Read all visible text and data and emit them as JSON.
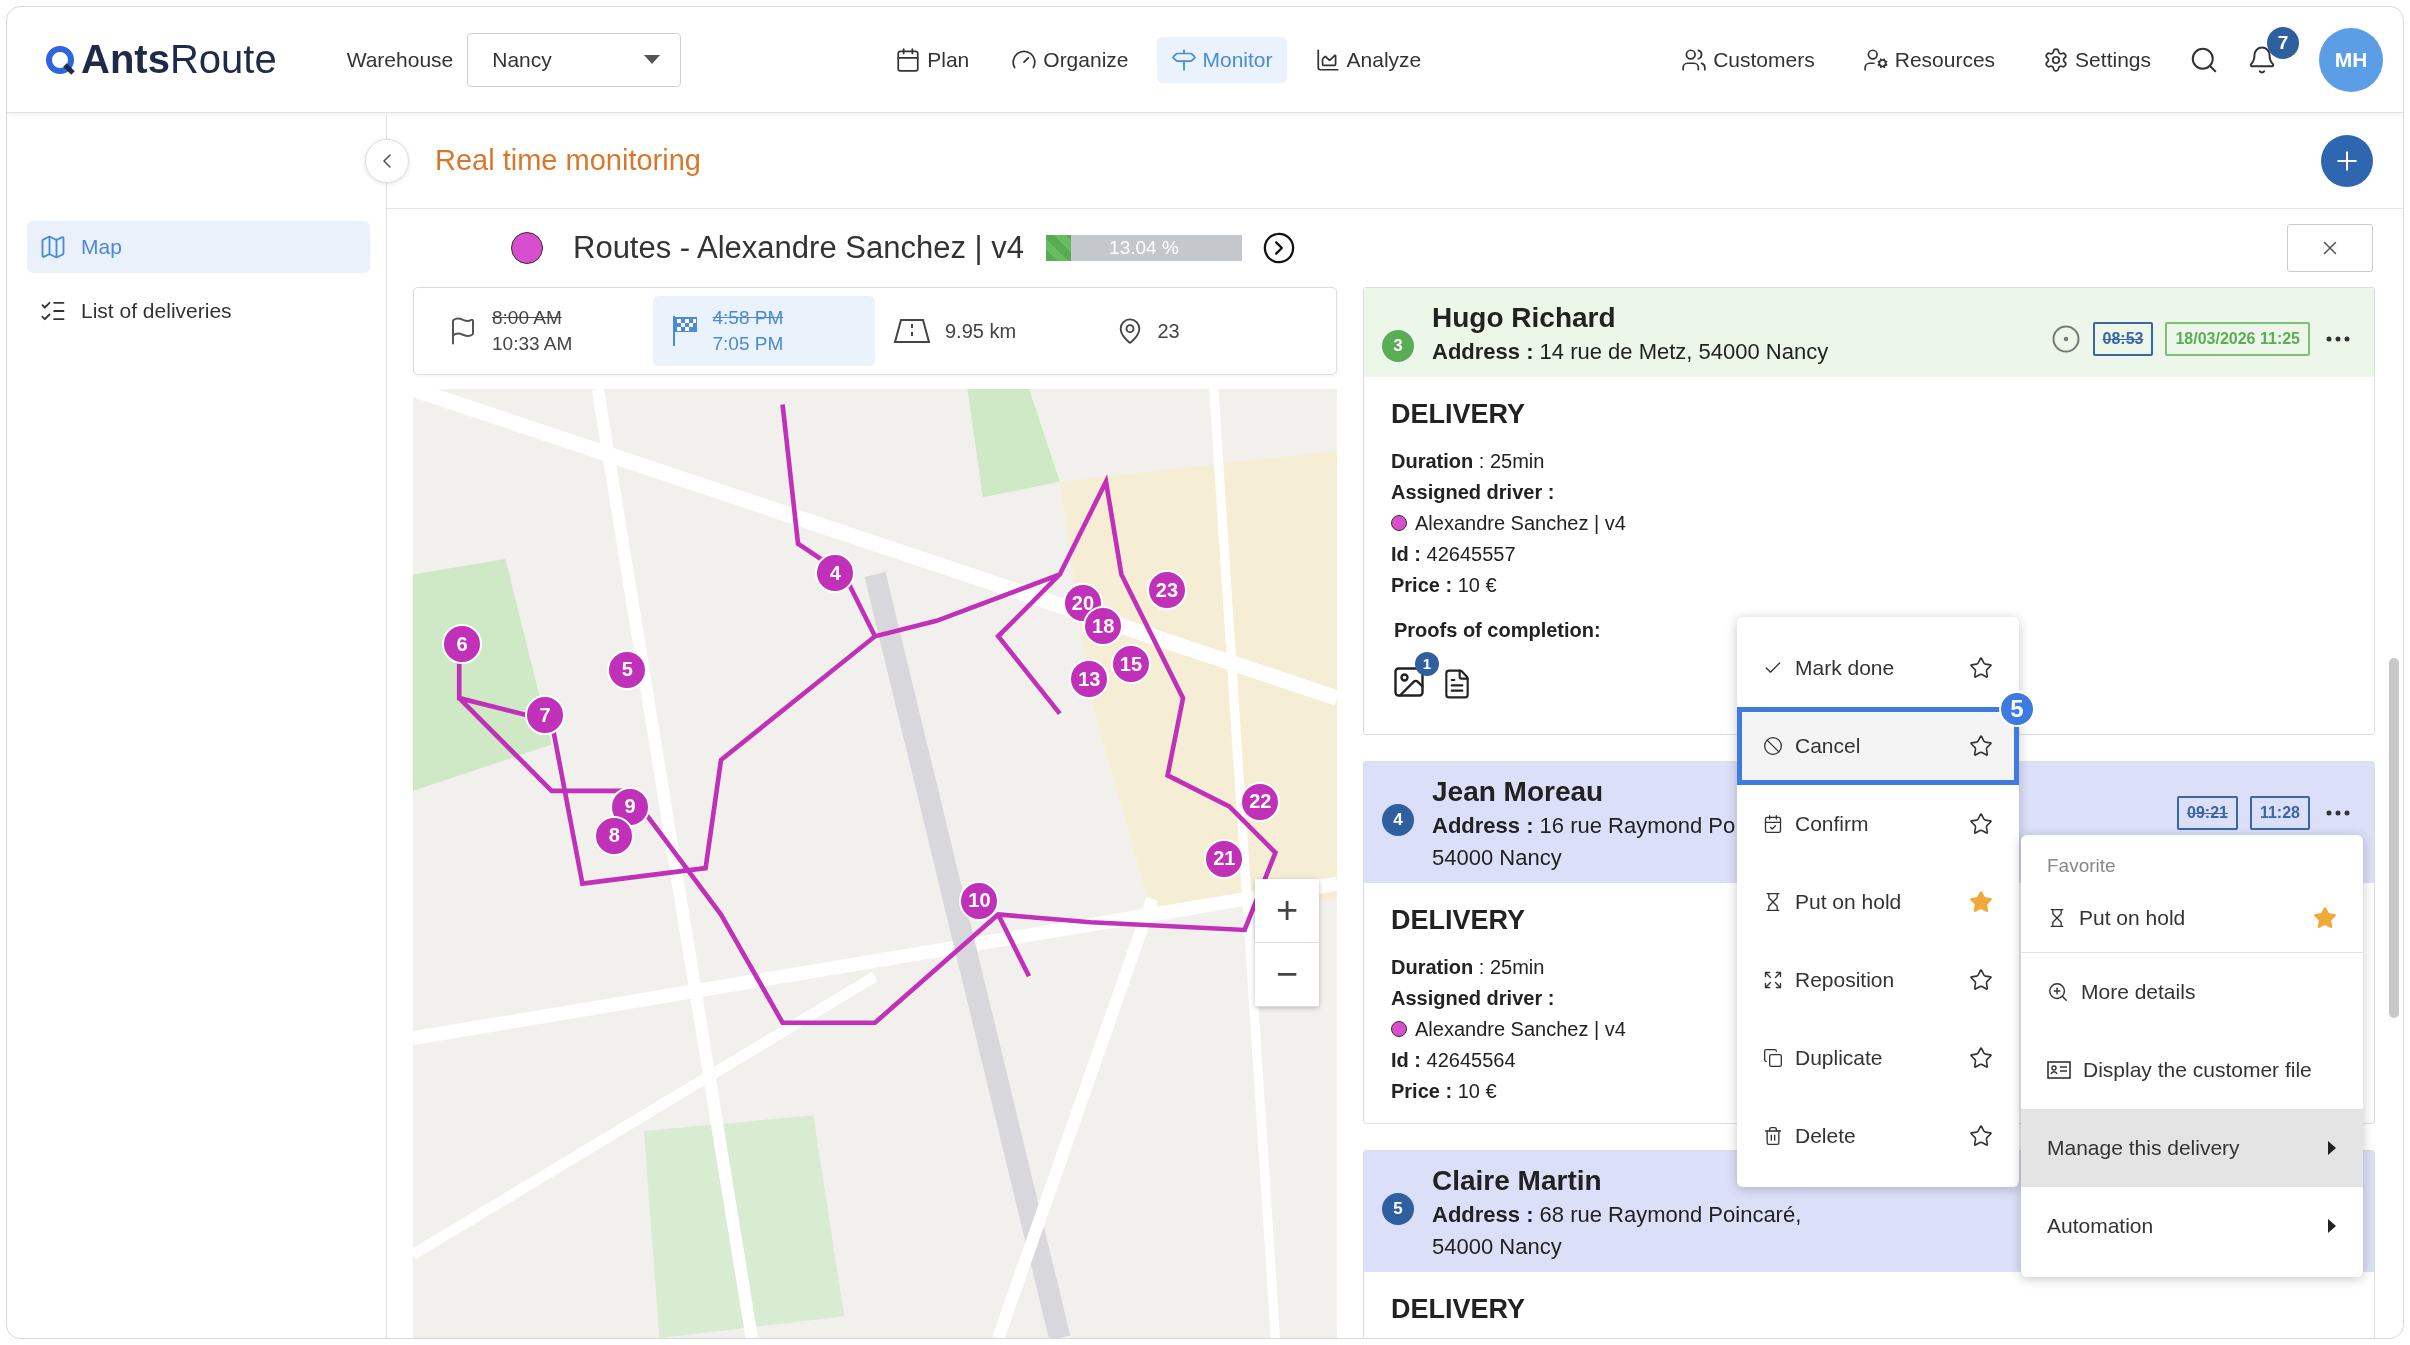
{
  "header": {
    "logo": {
      "bold": "Ants",
      "light": "Route"
    },
    "warehouse_label": "Warehouse",
    "warehouse": "Nancy",
    "nav": [
      {
        "kind": "plan",
        "label": "Plan",
        "selected": false
      },
      {
        "kind": "organize",
        "label": "Organize",
        "selected": false
      },
      {
        "kind": "monitor",
        "label": "Monitor",
        "selected": true
      },
      {
        "kind": "analyze",
        "label": "Analyze",
        "selected": false
      }
    ],
    "tools": [
      {
        "kind": "customers",
        "label": "Customers"
      },
      {
        "kind": "resources",
        "label": "Resources"
      },
      {
        "kind": "settings",
        "label": "Settings"
      }
    ],
    "notifications": "7",
    "avatar": "MH"
  },
  "sidebar": {
    "items": [
      {
        "kind": "map",
        "label": "Map",
        "selected": true
      },
      {
        "kind": "list",
        "label": "List of deliveries",
        "selected": false
      }
    ]
  },
  "page_title": "Real time monitoring",
  "route": {
    "color": "#d84fce",
    "title": "Routes - Alexandre Sanchez | v4",
    "progress": {
      "level": 0.1304,
      "reading": "13.04 %"
    }
  },
  "summary": [
    {
      "kind": "start",
      "planned": "8:00 AM",
      "actual": "10:33 AM",
      "selected": false
    },
    {
      "kind": "end",
      "planned": "4:58 PM",
      "actual": "7:05 PM",
      "selected": true
    },
    {
      "kind": "distance",
      "value": "9.95 km",
      "selected": false
    },
    {
      "kind": "stops",
      "value": "23",
      "selected": false
    }
  ],
  "map": {
    "zoom_in": "+",
    "zoom_out": "−",
    "pins": [
      "4",
      "5",
      "6",
      "7",
      "9",
      "8",
      "10",
      "20",
      "18",
      "13",
      "15",
      "23",
      "22",
      "21"
    ]
  },
  "stops": [
    {
      "number": "3",
      "completed": true,
      "name": "Hugo Richard",
      "tracked": true,
      "address": [
        "**Address :** 14 rue de Metz, 54000 Nancy"
      ],
      "times": [
        {
          "kind": "planned",
          "text": "08:53"
        },
        {
          "kind": "done",
          "text": "18/03/2026 11:25"
        }
      ],
      "details": {
        "type": "DELIVERY",
        "lines": [
          "**Duration** : 25min",
          "**Assigned driver :**"
        ],
        "driver": {
          "name": "Alexandre Sanchez | v4",
          "color": "#d84fce"
        },
        "after": [
          "**Id :** 42645557",
          "**Price :** 10 €"
        ],
        "proofs": {
          "label": "Proofs of completion:",
          "photo_count": "1"
        }
      }
    },
    {
      "number": "4",
      "completed": false,
      "name": "Jean Moreau",
      "tracked": false,
      "address": [
        "**Address :** 16 rue Raymond Po",
        "54000 Nancy"
      ],
      "times": [
        {
          "kind": "planned",
          "text": "09:21"
        },
        {
          "kind": "estimated",
          "text": "11:28"
        }
      ],
      "details": {
        "type": "DELIVERY",
        "lines": [
          "**Duration** : 25min",
          "**Assigned driver :**"
        ],
        "driver": {
          "name": "Alexandre Sanchez | v4",
          "color": "#d84fce"
        },
        "after": [
          "**Id :** 42645564",
          "**Price :** 10 €"
        ]
      }
    },
    {
      "number": "5",
      "completed": false,
      "name": "Claire Martin",
      "address": [
        "**Address :** 68 rue Raymond Poincaré,",
        "54000 Nancy"
      ],
      "details": {
        "type": "DELIVERY"
      }
    }
  ],
  "action_menu": [
    {
      "kind": "done",
      "label": "Mark done",
      "favorite": false,
      "selected": false
    },
    {
      "kind": "cancel",
      "label": "Cancel",
      "favorite": false,
      "selected": true,
      "step": "5"
    },
    {
      "kind": "confirm",
      "label": "Confirm",
      "favorite": false,
      "selected": false
    },
    {
      "kind": "hold",
      "label": "Put on hold",
      "favorite": true,
      "selected": false
    },
    {
      "kind": "reposition",
      "label": "Reposition",
      "favorite": false,
      "selected": false
    },
    {
      "kind": "duplicate",
      "label": "Duplicate",
      "favorite": false,
      "selected": false
    },
    {
      "kind": "delete",
      "label": "Delete",
      "favorite": false,
      "selected": false
    }
  ],
  "context_menu": {
    "favorite_heading": "Favorite",
    "favorite": {
      "kind": "hold",
      "label": "Put on hold",
      "favorite": true
    },
    "items": [
      {
        "kind": "details",
        "label": "More details",
        "submenu": false,
        "selected": false
      },
      {
        "kind": "customer",
        "label": "Display the customer file",
        "submenu": false,
        "selected": false
      },
      {
        "kind": "manage",
        "label": "Manage this delivery",
        "submenu": true,
        "selected": true
      },
      {
        "kind": "automation",
        "label": "Automation",
        "submenu": true,
        "selected": false
      }
    ]
  }
}
